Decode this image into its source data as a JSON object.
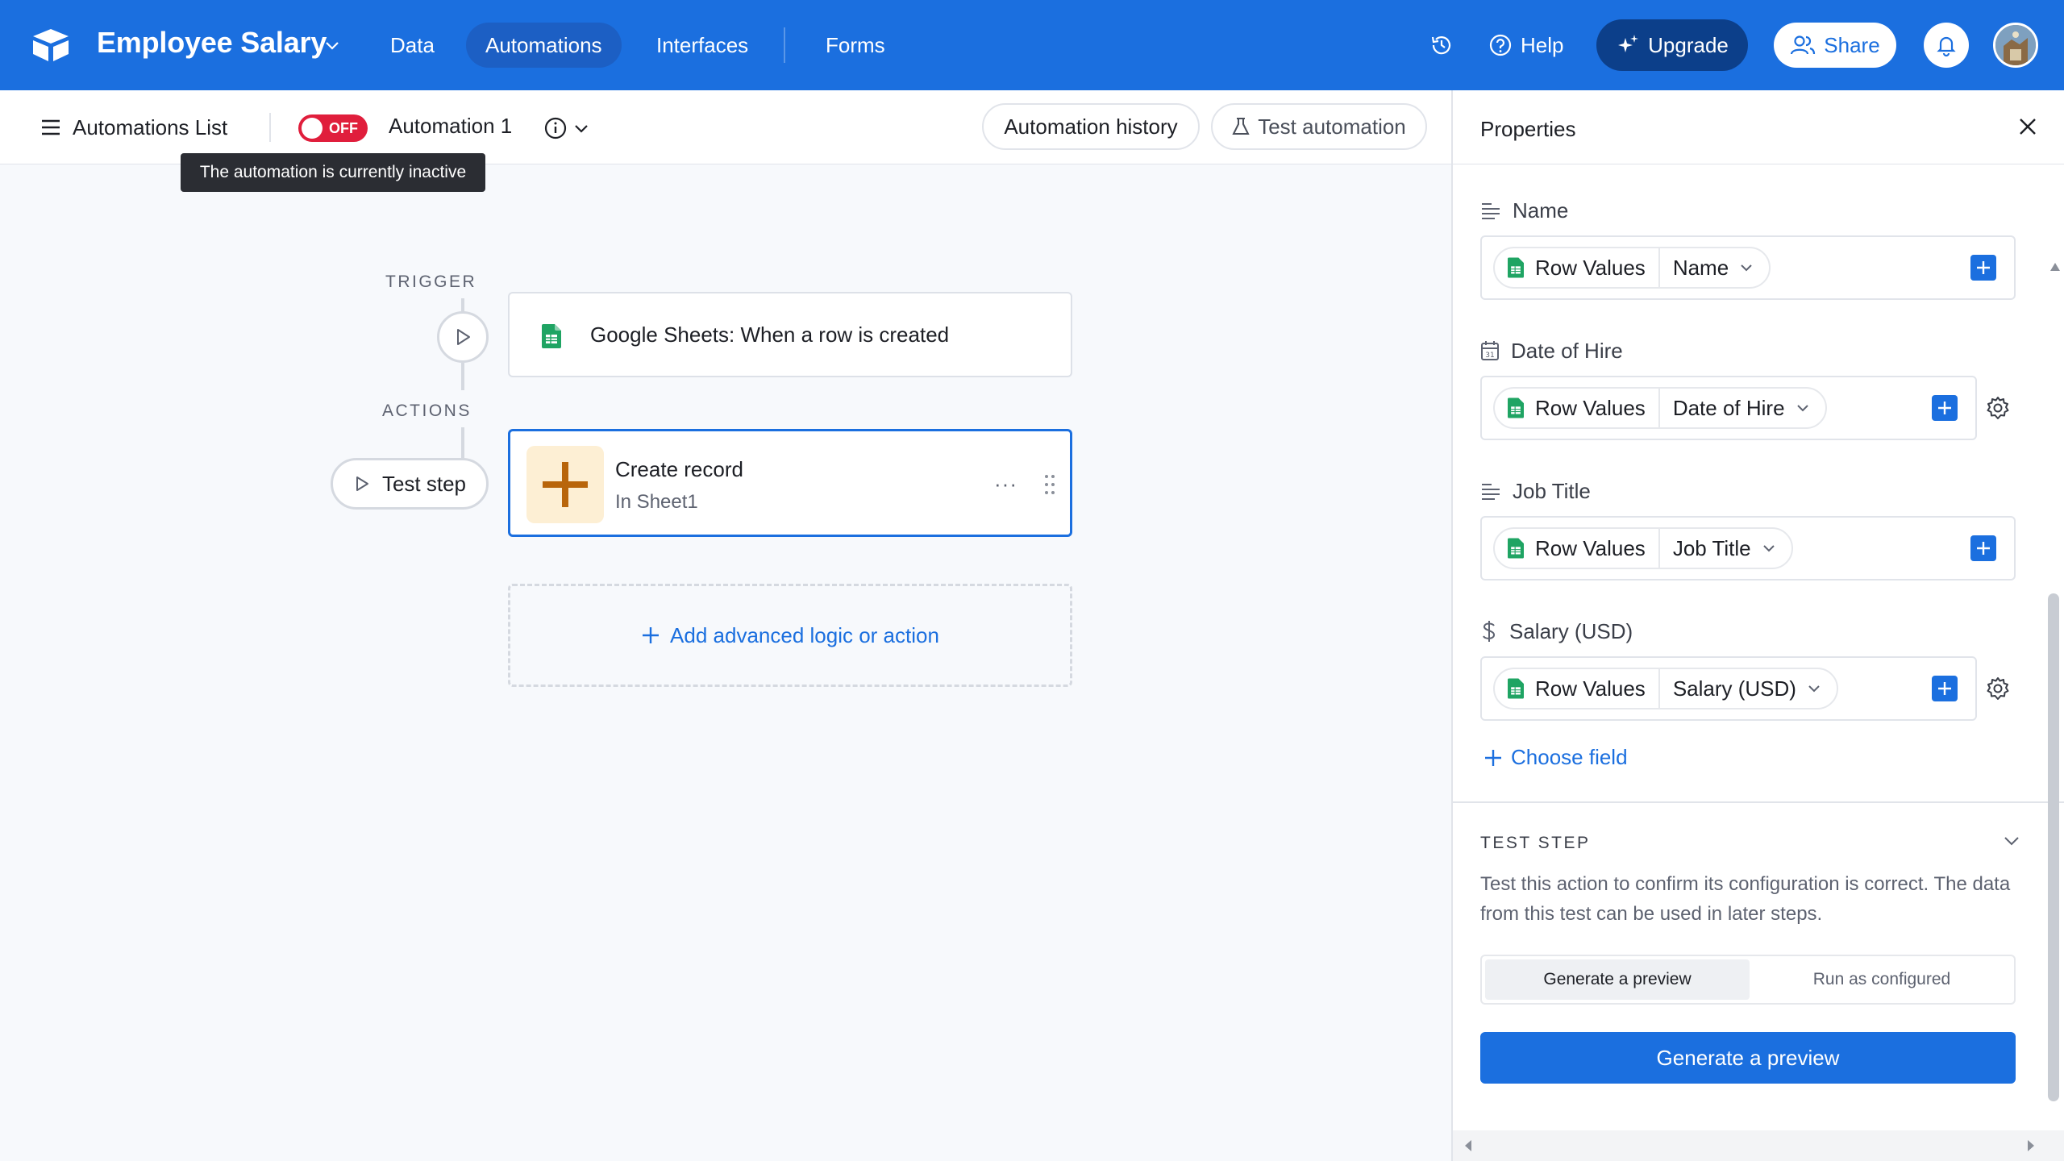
{
  "topbar": {
    "base_name": "Employee Salary",
    "nav": [
      "Data",
      "Automations",
      "Interfaces",
      "Forms"
    ],
    "help": "Help",
    "upgrade": "Upgrade",
    "share": "Share"
  },
  "subbar": {
    "list_label": "Automations List",
    "toggle_state": "OFF",
    "automation_name": "Automation 1",
    "history_btn": "Automation history",
    "test_btn": "Test automation",
    "tooltip": "The automation is currently inactive"
  },
  "canvas": {
    "trigger_label": "TRIGGER",
    "actions_label": "ACTIONS",
    "trigger_text": "Google Sheets: When a row is created",
    "test_step": "Test step",
    "action_title": "Create record",
    "action_sub": "In Sheet1",
    "action_menu": "···",
    "add_logic": "Add advanced logic or action"
  },
  "panel": {
    "title": "Properties",
    "fields": [
      {
        "label": "Name",
        "source": "Row Values",
        "value": "Name"
      },
      {
        "label": "Date of Hire",
        "source": "Row Values",
        "value": "Date of Hire"
      },
      {
        "label": "Job Title",
        "source": "Row Values",
        "value": "Job Title"
      },
      {
        "label": "Salary (USD)",
        "source": "Row Values",
        "value": "Salary (USD)"
      }
    ],
    "choose_field": "Choose field",
    "test_step_heading": "TEST STEP",
    "test_step_desc": "Test this action to confirm its configuration is correct. The data from this test can be used in later steps.",
    "seg_options": [
      "Generate a preview",
      "Run as configured"
    ],
    "generate_btn": "Generate a preview"
  },
  "colors": {
    "brand_blue": "#1b6fdf",
    "toggle_red": "#e01e3c",
    "action_icon_bg": "#fdefd4",
    "action_icon_fg": "#b8650b"
  }
}
